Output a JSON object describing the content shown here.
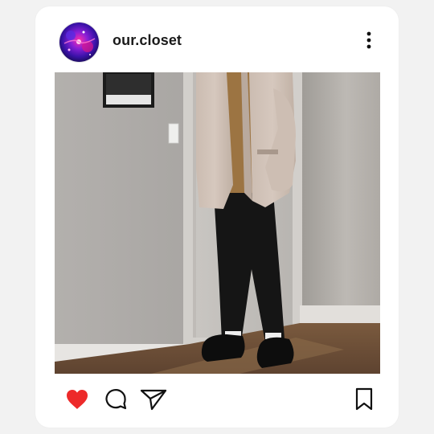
{
  "post": {
    "username": "our.closet",
    "avatar_icon": "galaxy-avatar",
    "photo_icon": "outfit-photo",
    "menu_icon": "more-vertical-icon"
  },
  "actions": {
    "like_icon": "heart-icon",
    "like_color": "#ed2a2a",
    "comment_icon": "comment-icon",
    "share_icon": "send-icon",
    "save_icon": "bookmark-icon"
  }
}
